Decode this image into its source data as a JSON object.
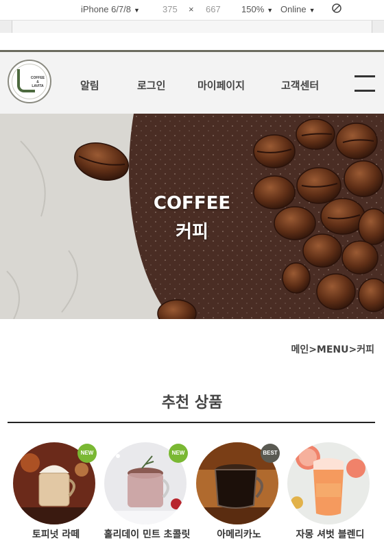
{
  "devtools": {
    "device": "iPhone 6/7/8",
    "width": "375",
    "times": "×",
    "height": "667",
    "zoom": "150%",
    "network": "Online"
  },
  "header": {
    "logo_lines": [
      "COFFEE",
      "&",
      "LAVITA"
    ],
    "nav": [
      "알림",
      "로그인",
      "마이페이지",
      "고객센터"
    ]
  },
  "hero": {
    "title_en": "COFFEE",
    "title_ko": "커피"
  },
  "breadcrumb": "메인>MENU>커피",
  "recommended": {
    "title": "추천 상품",
    "products": [
      {
        "name": "토피넛 라떼",
        "badge": "NEW",
        "badge_color": "#7ab833"
      },
      {
        "name": "홀리데이 민트 초콜릿",
        "badge": "NEW",
        "badge_color": "#7ab833"
      },
      {
        "name": "아메리카노",
        "badge": "BEST",
        "badge_color": "#5a5a52"
      },
      {
        "name": "자몽 셔벗 블렌디",
        "badge": "",
        "badge_color": ""
      }
    ]
  }
}
